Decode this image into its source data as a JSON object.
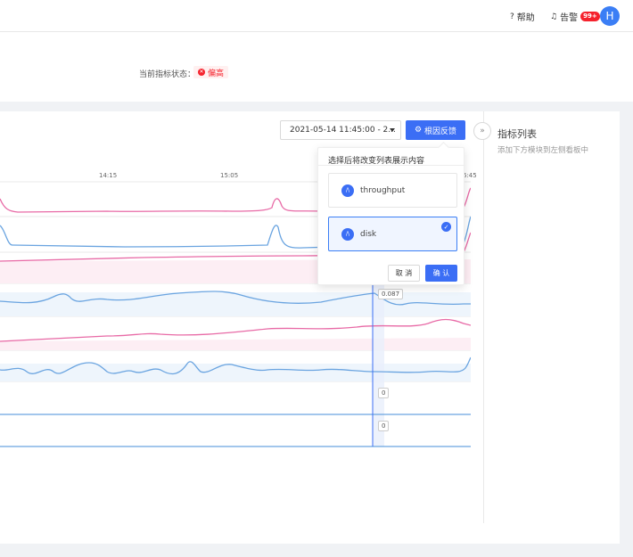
{
  "header": {
    "help_label": "帮助",
    "alarm_label": "告警",
    "alarm_count": "99+",
    "avatar_letter": "H"
  },
  "status": {
    "label": "当前指标状态：",
    "value": "偏高",
    "color": "#f5222d"
  },
  "toolbar": {
    "date_range": "2021-05-14 11:45:00 - 2...",
    "root_cause_button": "根因反馈",
    "collapse_icon": "double-chevron-right-icon"
  },
  "sidebar": {
    "title": "指标列表",
    "hint": "添加下方模块到左侧看板中"
  },
  "chart": {
    "time_labels": [
      "14:15",
      "15:05",
      "6:45"
    ],
    "tooltip_values": [
      "0.087",
      "0",
      "0"
    ],
    "colors": {
      "pink": "#e86aa6",
      "blue": "#6aa4e0",
      "accent": "#3b6ef5"
    }
  },
  "dropdown": {
    "title": "选择后将改变列表展示内容",
    "items": [
      {
        "label": "throughput",
        "selected": false
      },
      {
        "label": "disk",
        "selected": true
      }
    ],
    "cancel_label": "取 消",
    "ok_label": "确 认"
  }
}
